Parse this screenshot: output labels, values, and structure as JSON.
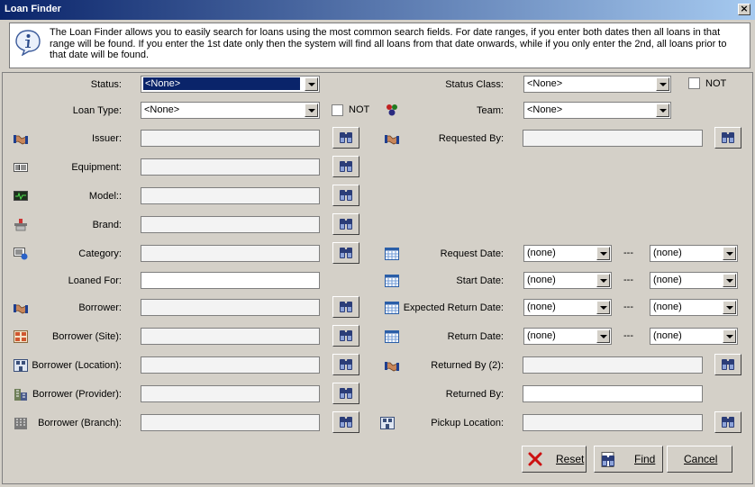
{
  "window": {
    "title": "Loan Finder"
  },
  "info": {
    "text": "The Loan Finder allows you to easily search for loans using the most common search fields. For date ranges, if you enter both dates then all loans in that range will be found. If you enter the 1st date only then the system will find all loans from that date onwards, while if you only enter the 2nd, all loans prior to that date will be found."
  },
  "left": {
    "status": {
      "label": "Status:",
      "value": "<None>"
    },
    "loan_type": {
      "label": "Loan Type:",
      "value": "<None>",
      "not_label": "NOT"
    },
    "issuer": {
      "label": "Issuer:",
      "value": ""
    },
    "equipment": {
      "label": "Equipment:",
      "value": ""
    },
    "model": {
      "label": "Model::",
      "value": ""
    },
    "brand": {
      "label": "Brand:",
      "value": ""
    },
    "category": {
      "label": "Category:",
      "value": ""
    },
    "loaned_for": {
      "label": "Loaned For:",
      "value": ""
    },
    "borrower": {
      "label": "Borrower:",
      "value": ""
    },
    "borrower_site": {
      "label": "Borrower (Site):",
      "value": ""
    },
    "borrower_location": {
      "label": "Borrower (Location):",
      "value": ""
    },
    "borrower_provider": {
      "label": "Borrower (Provider):",
      "value": ""
    },
    "borrower_branch": {
      "label": "Borrower (Branch):",
      "value": ""
    }
  },
  "right": {
    "status_class": {
      "label": "Status Class:",
      "value": "<None>",
      "not_label": "NOT"
    },
    "team": {
      "label": "Team:",
      "value": "<None>"
    },
    "requested_by": {
      "label": "Requested By:",
      "value": ""
    },
    "request_date": {
      "label": "Request Date:",
      "from": "(none)",
      "to": "(none)"
    },
    "start_date": {
      "label": "Start Date:",
      "from": "(none)",
      "to": "(none)"
    },
    "expected_return_date": {
      "label": "Expected Return Date:",
      "from": "(none)",
      "to": "(none)"
    },
    "return_date": {
      "label": "Return Date:",
      "from": "(none)",
      "to": "(none)"
    },
    "returned_by_2": {
      "label": "Returned By (2):",
      "value": ""
    },
    "returned_by": {
      "label": "Returned By:",
      "value": ""
    },
    "pickup_location": {
      "label": "Pickup Location:",
      "value": ""
    },
    "range_separator": "---"
  },
  "buttons": {
    "reset": "Reset",
    "find": "Find",
    "cancel": "Cancel"
  },
  "colors": {
    "selection": "#0a246a",
    "title_start": "#0a246a",
    "title_end": "#a6caf0",
    "window_bg": "#d4d0c8",
    "reset_x": "#cc1111"
  }
}
